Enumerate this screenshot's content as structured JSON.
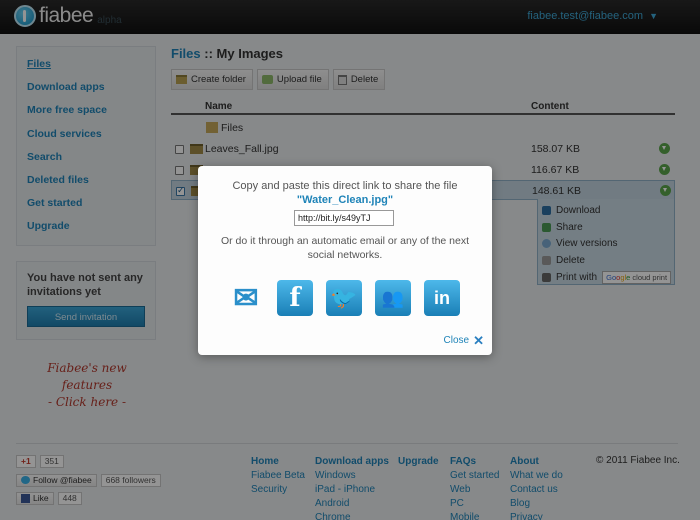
{
  "header": {
    "logo_text": "fiabee",
    "logo_sub": "alpha",
    "user_email": "fiabee.test@fiabee.com"
  },
  "sidebar": {
    "items": [
      {
        "label": "Files"
      },
      {
        "label": "Download apps"
      },
      {
        "label": "More free space"
      },
      {
        "label": "Cloud services"
      },
      {
        "label": "Search"
      },
      {
        "label": "Deleted files"
      },
      {
        "label": "Get started"
      },
      {
        "label": "Upgrade"
      }
    ],
    "invite_text": "You have not sent any invitations yet",
    "invite_button": "Send invitation",
    "new_features_line1": "Fiabee's new features",
    "new_features_line2": "- Click here -"
  },
  "main": {
    "breadcrumb_root": "Files",
    "breadcrumb_sep": "::",
    "breadcrumb_current": "My Images",
    "toolbar": {
      "create_folder": "Create folder",
      "upload_file": "Upload file",
      "delete": "Delete"
    },
    "columns": {
      "name": "Name",
      "content": "Content"
    },
    "parent_folder": "Files",
    "rows": [
      {
        "name": "Leaves_Fall.jpg",
        "size": "158.07 KB",
        "checked": false
      },
      {
        "name": "",
        "size": "116.67 KB",
        "checked": false
      },
      {
        "name": "",
        "size": "148.61 KB",
        "checked": true
      }
    ],
    "context_menu": {
      "download": "Download",
      "share": "Share",
      "view_versions": "View versions",
      "delete": "Delete",
      "print_with": "Print with",
      "print_badge_1": "Go",
      "print_badge_2": "o",
      "print_badge_3": "gl",
      "print_badge_4": "e",
      "print_badge_rest": "cloud print"
    }
  },
  "modal": {
    "line1": "Copy and paste this direct link to share the file",
    "filename": "\"Water_Clean.jpg\"",
    "link_value": "http://bit.ly/s49yTJ",
    "line2": "Or do it through an automatic email or any of the next social networks.",
    "icons": {
      "mail": "✉",
      "facebook": "f",
      "twitter": "🐦",
      "myspace": "👥",
      "linkedin": "in"
    },
    "close_label": "Close",
    "close_glyph": "✕"
  },
  "footer": {
    "gplus_label": "+1",
    "gplus_count": "351",
    "twitter_label": "Follow @fiabee",
    "twitter_count": "668 followers",
    "fb_label": "Like",
    "fb_count": "448",
    "col_home": {
      "heading": "Home",
      "links": [
        "Fiabee Beta",
        "Security"
      ]
    },
    "col_download": {
      "heading": "Download apps",
      "links": [
        "Windows",
        "iPad - iPhone",
        "Android",
        "Chrome"
      ]
    },
    "col_upgrade": {
      "heading": "Upgrade",
      "links": []
    },
    "col_faqs": {
      "heading": "FAQs",
      "links": [
        "Get started",
        "Web",
        "PC",
        "Mobile"
      ]
    },
    "col_about": {
      "heading": "About",
      "links": [
        "What we do",
        "Contact us",
        "Blog",
        "Privacy"
      ]
    },
    "copyright": "© 2011 Fiabee Inc."
  },
  "colors": {
    "accent": "#1f84b8",
    "overlay": "#000000",
    "new_features": "#b2372c"
  }
}
